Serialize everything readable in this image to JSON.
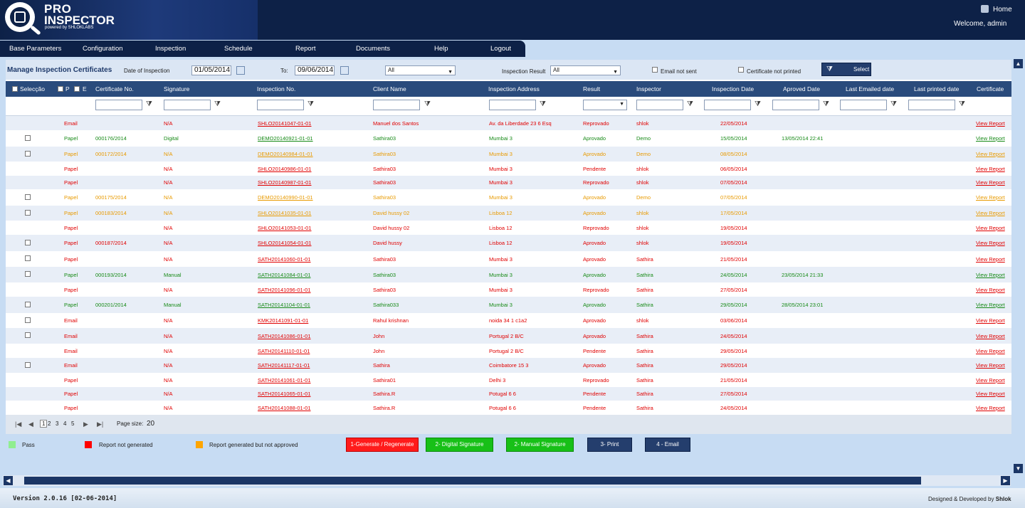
{
  "app": {
    "logo_pro": "PRO",
    "logo_inspector": "INSPECTOR",
    "logo_powered": "powered by SHLOKLABS",
    "home_label": "Home",
    "welcome": "Welcome, admin"
  },
  "menu": [
    "Base Parameters",
    "Configuration",
    "Inspection",
    "Schedule",
    "Report",
    "Documents",
    "Help",
    "Logout"
  ],
  "toolbar": {
    "title": "Manage Inspection Certificates",
    "date_label": "Date of Inspection",
    "date_from": "01/05/2014",
    "to_label": "To:",
    "date_to": "09/06/2014",
    "status_select": "All",
    "result_label": "Inspection Result",
    "result_select": "All",
    "email_not_sent": "Email not sent",
    "cert_not_printed": "Certificate not printed",
    "select_button": "Select"
  },
  "columns": {
    "selection": "Selecção",
    "p": "P",
    "e": "E",
    "cert_no": "Certificate No.",
    "signature": "Signature",
    "insp_no": "Inspection No.",
    "client": "Client Name",
    "address": "Inspection Address",
    "result": "Result",
    "inspector": "Inspector",
    "insp_date": "Inspection Date",
    "approved_date": "Aproved Date",
    "last_emailed": "Last Emailed date",
    "last_printed": "Last printed date",
    "certificate": "Certificate"
  },
  "rows": [
    {
      "chk": false,
      "type": "Email",
      "cert": "",
      "sig": "N/A",
      "insp": "SHLO20141047-01-01",
      "client": "Manuel dos Santos",
      "addr": "Av. da Liberdade 23 6 Esq",
      "result": "Reprovado",
      "inspector": "shlok",
      "idate": "22/05/2014",
      "adate": "",
      "color": "red",
      "link": "View Report"
    },
    {
      "chk": true,
      "type": "Papel",
      "cert": "000176/2014",
      "sig": "Digital",
      "insp": "DEMO20140921-01-01",
      "client": "Sathira03",
      "addr": "Mumbai 3",
      "result": "Aprovado",
      "inspector": "Demo",
      "idate": "15/05/2014",
      "adate": "13/05/2014 22:41",
      "color": "green",
      "link": "View Report"
    },
    {
      "chk": true,
      "type": "Papel",
      "cert": "000172/2014",
      "sig": "N/A",
      "insp": "DEMO20140984-01-01",
      "client": "Sathira03",
      "addr": "Mumbai 3",
      "result": "Aprovado",
      "inspector": "Demo",
      "idate": "08/05/2014",
      "adate": "",
      "color": "orange",
      "link": "View Report"
    },
    {
      "chk": false,
      "type": "Papel",
      "cert": "",
      "sig": "N/A",
      "insp": "SHLO20140986-01-01",
      "client": "Sathira03",
      "addr": "Mumbai 3",
      "result": "Pendente",
      "inspector": "shlok",
      "idate": "06/05/2014",
      "adate": "",
      "color": "red",
      "link": "View Report"
    },
    {
      "chk": false,
      "type": "Papel",
      "cert": "",
      "sig": "N/A",
      "insp": "SHLO20140987-01-01",
      "client": "Sathira03",
      "addr": "Mumbai 3",
      "result": "Reprovado",
      "inspector": "shlok",
      "idate": "07/05/2014",
      "adate": "",
      "color": "red",
      "link": "View Report"
    },
    {
      "chk": true,
      "type": "Papel",
      "cert": "000175/2014",
      "sig": "N/A",
      "insp": "DEMO20140990-01-01",
      "client": "Sathira03",
      "addr": "Mumbai 3",
      "result": "Aprovado",
      "inspector": "Demo",
      "idate": "07/05/2014",
      "adate": "",
      "color": "orange",
      "link": "View Report"
    },
    {
      "chk": true,
      "type": "Papel",
      "cert": "000183/2014",
      "sig": "N/A",
      "insp": "SHLO20141035-01-01",
      "client": "David hussy 02",
      "addr": "Lisboa 12",
      "result": "Aprovado",
      "inspector": "shlok",
      "idate": "17/05/2014",
      "adate": "",
      "color": "orange",
      "link": "View Report"
    },
    {
      "chk": false,
      "type": "Papel",
      "cert": "",
      "sig": "N/A",
      "insp": "SHLO20141053-01-01",
      "client": "David hussy 02",
      "addr": "Lisboa 12",
      "result": "Reprovado",
      "inspector": "shlok",
      "idate": "19/05/2014",
      "adate": "",
      "color": "red",
      "link": "View Report"
    },
    {
      "chk": true,
      "type": "Papel",
      "cert": "000187/2014",
      "sig": "N/A",
      "insp": "SHLO20141054-01-01",
      "client": "David hussy",
      "addr": "Lisboa 12",
      "result": "Aprovado",
      "inspector": "shlok",
      "idate": "19/05/2014",
      "adate": "",
      "color": "red",
      "link": "View Report"
    },
    {
      "chk": true,
      "type": "Papel",
      "cert": "",
      "sig": "N/A",
      "insp": "SATH20141060-01-01",
      "client": "Sathira03",
      "addr": "Mumbai 3",
      "result": "Aprovado",
      "inspector": "Sathira",
      "idate": "21/05/2014",
      "adate": "",
      "color": "red",
      "link": "View Report"
    },
    {
      "chk": true,
      "type": "Papel",
      "cert": "000193/2014",
      "sig": "Manual",
      "insp": "SATH20141084-01-01",
      "client": "Sathira03",
      "addr": "Mumbai 3",
      "result": "Aprovado",
      "inspector": "Sathira",
      "idate": "24/05/2014",
      "adate": "23/05/2014 21:33",
      "color": "green",
      "link": "View Report"
    },
    {
      "chk": false,
      "type": "Papel",
      "cert": "",
      "sig": "N/A",
      "insp": "SATH20141096-01-01",
      "client": "Sathira03",
      "addr": "Mumbai 3",
      "result": "Reprovado",
      "inspector": "Sathira",
      "idate": "27/05/2014",
      "adate": "",
      "color": "red",
      "link": "View Report"
    },
    {
      "chk": true,
      "type": "Papel",
      "cert": "000201/2014",
      "sig": "Manual",
      "insp": "SATH20141104-01-01",
      "client": "Sathira033",
      "addr": "Mumbai 3",
      "result": "Aprovado",
      "inspector": "Sathira",
      "idate": "29/05/2014",
      "adate": "28/05/2014 23:01",
      "color": "green",
      "link": "View Report"
    },
    {
      "chk": true,
      "type": "Email",
      "cert": "",
      "sig": "N/A",
      "insp": "KMK20141091-01-01",
      "client": "Rahul krishnan",
      "addr": "noida 34 1 c1a2",
      "result": "Aprovado",
      "inspector": "shlok",
      "idate": "03/06/2014",
      "adate": "",
      "color": "red",
      "link": "View Report"
    },
    {
      "chk": true,
      "type": "Email",
      "cert": "",
      "sig": "N/A",
      "insp": "SATH20141086-01-01",
      "client": "John",
      "addr": "Portugal 2 B/C",
      "result": "Aprovado",
      "inspector": "Sathira",
      "idate": "24/05/2014",
      "adate": "",
      "color": "red",
      "link": "View Report"
    },
    {
      "chk": false,
      "type": "Email",
      "cert": "",
      "sig": "N/A",
      "insp": "SATH20141110-01-01",
      "client": "John",
      "addr": "Portugal 2 B/C",
      "result": "Pendente",
      "inspector": "Sathira",
      "idate": "29/05/2014",
      "adate": "",
      "color": "red",
      "link": "View Report"
    },
    {
      "chk": true,
      "type": "Email",
      "cert": "",
      "sig": "N/A",
      "insp": "SATH20141117-01-01",
      "client": "Sathira",
      "addr": "Coimbatore 15 3",
      "result": "Aprovado",
      "inspector": "Sathira",
      "idate": "29/05/2014",
      "adate": "",
      "color": "red",
      "link": "View Report"
    },
    {
      "chk": false,
      "type": "Papel",
      "cert": "",
      "sig": "N/A",
      "insp": "SATH20141061-01-01",
      "client": "Sathira01",
      "addr": "Delhi 3",
      "result": "Reprovado",
      "inspector": "Sathira",
      "idate": "21/05/2014",
      "adate": "",
      "color": "red",
      "link": "View Report"
    },
    {
      "chk": false,
      "type": "Papel",
      "cert": "",
      "sig": "N/A",
      "insp": "SATH20141065-01-01",
      "client": "Sathira.R",
      "addr": "Potugal 6 6",
      "result": "Pendente",
      "inspector": "Sathira",
      "idate": "27/05/2014",
      "adate": "",
      "color": "red",
      "link": "View Report"
    },
    {
      "chk": false,
      "type": "Papel",
      "cert": "",
      "sig": "N/A",
      "insp": "SATH20141088-01-01",
      "client": "Sathira.R",
      "addr": "Potugal 6 6",
      "result": "Pendente",
      "inspector": "Sathira",
      "idate": "24/05/2014",
      "adate": "",
      "color": "red",
      "link": "View Report"
    }
  ],
  "pager": {
    "pages": [
      "1",
      "2",
      "3",
      "4",
      "5"
    ],
    "current": "1",
    "page_size_label": "Page size:",
    "page_size": "20"
  },
  "legend": {
    "pass": "Pass",
    "not_generated": "Report not generated",
    "not_approved": "Report generated but not approved"
  },
  "actions": {
    "generate": "1-Generate / Regenerate",
    "digital": "2- Digital Signature",
    "manual": "2- Manual Signature",
    "print": "3- Print",
    "email": "4 - Email"
  },
  "footer": {
    "version": "Version 2.0.16 [02-06-2014]",
    "designed_prefix": "Designed & Developed by",
    "designed_by": "Shlok"
  },
  "colors": {
    "red": "#e00000",
    "green": "#178a17",
    "orange": "#e89a00",
    "navy": "#0d2147",
    "pass_swatch": "#90ee90",
    "not_generated_swatch": "#ff0000",
    "not_approved_swatch": "#ffa500"
  }
}
